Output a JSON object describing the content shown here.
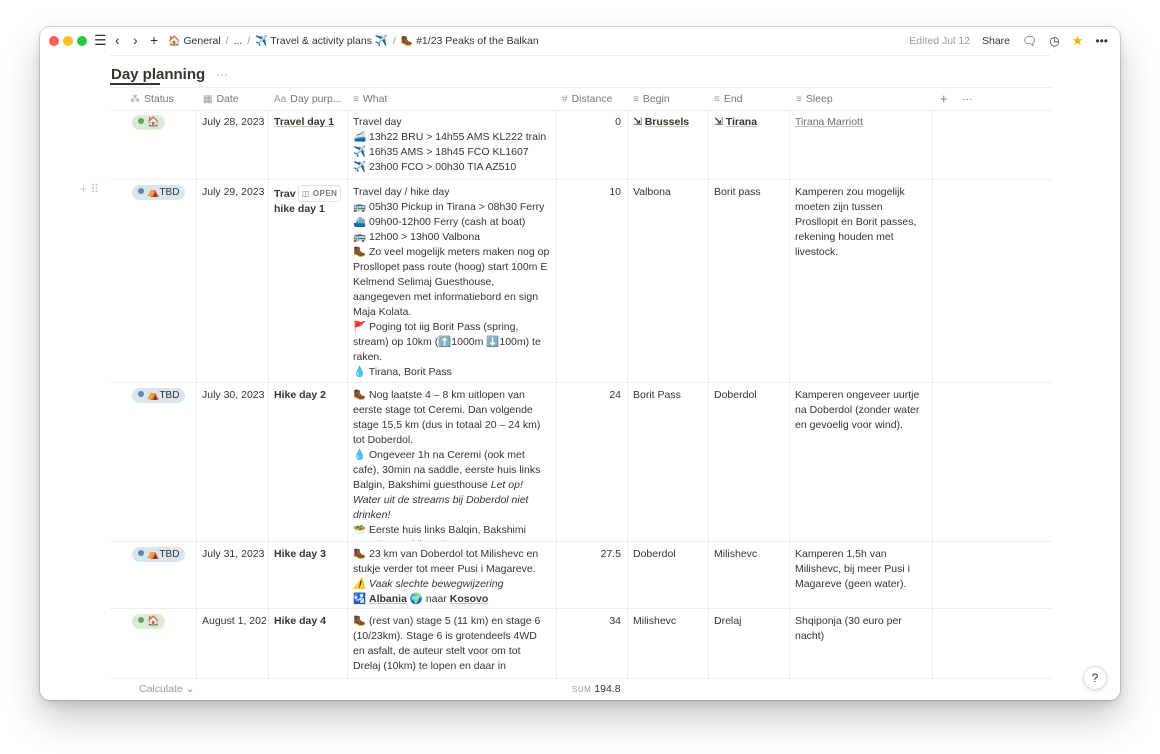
{
  "titlebar": {
    "breadcrumb": [
      {
        "icon": "🏠",
        "label": "General"
      },
      {
        "label": "..."
      },
      {
        "icon": "✈️",
        "label": "Travel & activity plans ✈️"
      },
      {
        "icon": "🥾",
        "label": "#1/23 Peaks of the Balkan"
      }
    ],
    "edited": "Edited Jul 12",
    "share": "Share"
  },
  "view": {
    "title": "Day planning",
    "more": "···"
  },
  "columns": [
    {
      "icon": "⁂",
      "label": "Status"
    },
    {
      "icon": "▦",
      "label": "Date"
    },
    {
      "icon": "Aa",
      "label": "Day purp..."
    },
    {
      "icon": "≡",
      "label": "What"
    },
    {
      "icon": "#",
      "label": "Distance"
    },
    {
      "icon": "≡",
      "label": "Begin"
    },
    {
      "icon": "≡",
      "label": "End"
    },
    {
      "icon": "≡",
      "label": "Sleep"
    }
  ],
  "add_column": "+",
  "more_columns": "···",
  "open_label": "OPEN",
  "rows": [
    {
      "status": "🏠",
      "status_color": "green",
      "date": "July 28, 2023",
      "purpose": "Travel day 1",
      "what": [
        "Travel day",
        "🚄 13h22 BRU > 14h55 AMS KL222 train",
        "✈️ 16h35 AMS > 18h45 FCO KL1607",
        "✈️ 23h00 FCO > 00h30 TIA AZ510"
      ],
      "distance": "0",
      "begin": "Brussels",
      "end": "Tirana",
      "sleep": "Tirana Marriott"
    },
    {
      "status": "⛺TBD",
      "status_color": "blue",
      "date": "July 29, 2023",
      "purpose_1": "Travel day 1",
      "purpose_2": "hike day 1",
      "what": [
        "Travel day / hike day",
        "🚌 05h30 Pickup in Tirana > 08h30 Ferry",
        "⛴️ 09h00-12h00 Ferry (cash at boat)",
        "🚌 12h00 > 13h00 Valbona",
        "🥾 Zo veel mogelijk meters maken nog op Prosllopet pass route (hoog) start 100m E Kelmend Selimaj Guesthouse, aangegeven met informatiebord en sign Maja Kolata.",
        "🚩 Poging tot iig Borit Pass (spring, stream) op 10km (⬆️1000m ⬇️100m) te raken.",
        "💧 Tirana, Borit Pass",
        "🥗 -"
      ],
      "distance": "10",
      "begin": "Valbona",
      "end": "Borit pass",
      "sleep": "Kamperen zou mogelijk moeten zijn tussen Prosllopit en Borit passes, rekening houden met livestock."
    },
    {
      "status": "⛺TBD",
      "status_color": "blue",
      "date": "July 30, 2023",
      "purpose": "Hike day 2",
      "what_1": "🥾 Nog laatste 4 – 8 km uitlopen van eerste stage tot Ceremi. Dan volgende stage 15,5 km (dus in totaal 20 – 24 km) tot Doberdol.",
      "what_2": "💧 Ongeveer 1h na Ceremi (ook met cafe), 30min na saddle, eerste huis links Balgin, Bakshimi guesthouse ",
      "what_2_italic": "Let op! Water uit de streams bij Doberdol niet drinken!",
      "what_3": "🥗 Eerste huis links Balqin, Bakshimi guesthouse (diner?)",
      "distance": "24",
      "begin": "Borit Pass",
      "end": "Doberdol",
      "sleep": "Kamperen ongeveer uurtje na Doberdol (zonder water en gevoelig voor wind)."
    },
    {
      "status": "⛺TBD",
      "status_color": "blue",
      "date": "July 31, 2023",
      "purpose": "Hike day 3",
      "what_1": "🥾 23 km van Doberdol tot Milishevc en stukje verder tot meer Pusi i Magareve.",
      "what_2": "⚠️ Vaak slechte bewegwijzering",
      "what_3a": "🛂 ",
      "what_3_link1": "Albania",
      "what_3b": " 🌍 naar ",
      "what_3_link2": "Kosovo",
      "distance": "27.5",
      "begin": "Doberdol",
      "end": "Milishevc",
      "sleep": "Kamperen 1,5h van Milishevc, bij meer Pusi i Magareve (geen water)."
    },
    {
      "status": "🏠",
      "status_color": "green",
      "date": "August 1, 2023",
      "purpose": "Hike day 4",
      "what": "🥾 (rest van) stage 5 (11 km) en stage 6 (10/23km). Stage 6 is grotendeels 4WD en asfalt, de auteur stelt voor om tot Drelaj (10km) te lopen en daar in",
      "distance": "34",
      "begin": "Milishevc",
      "end": "Drelaj",
      "sleep": "Shqiponja (30 euro per nacht)"
    }
  ],
  "footer": {
    "calculate": "Calculate ⌄",
    "sum_label": "SUM",
    "sum_value": "194.8"
  },
  "help": "?"
}
